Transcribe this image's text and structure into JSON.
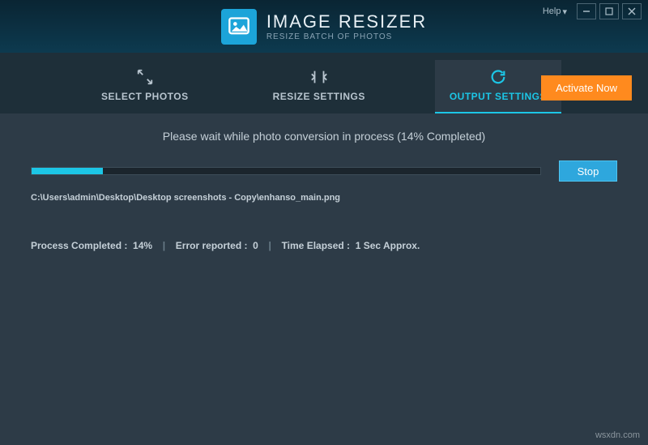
{
  "window": {
    "help_label": "Help"
  },
  "brand": {
    "title": "IMAGE RESIZER",
    "tagline": "RESIZE BATCH OF PHOTOS"
  },
  "tabs": {
    "select_photos": "SELECT PHOTOS",
    "resize_settings": "RESIZE SETTINGS",
    "output_settings": "OUTPUT SETTINGS"
  },
  "cta": {
    "activate": "Activate Now"
  },
  "progress": {
    "status_text": "Please wait while photo conversion in process  (14% Completed)",
    "percent": 14,
    "stop_label": "Stop",
    "current_file": "C:\\Users\\admin\\Desktop\\Desktop screenshots - Copy\\enhanso_main.png"
  },
  "stats": {
    "process_completed_label": "Process Completed :",
    "process_completed_value": "14%",
    "error_reported_label": "Error reported :",
    "error_reported_value": "0",
    "time_elapsed_label": "Time Elapsed :",
    "time_elapsed_value": "1 Sec  Approx."
  },
  "watermark": "wsxdn.com"
}
